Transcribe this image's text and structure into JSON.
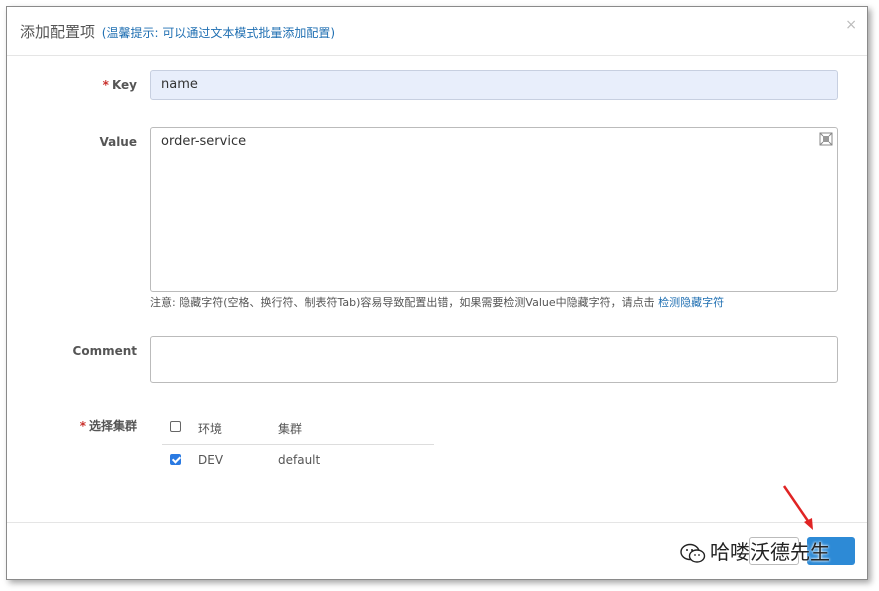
{
  "dialog": {
    "title": "添加配置项",
    "hint": "(温馨提示: 可以通过文本模式批量添加配置)",
    "close_glyph": "×"
  },
  "form": {
    "key_label": "Key",
    "key_value": "name",
    "value_label": "Value",
    "value_text": "order-service",
    "note_text": "注意: 隐藏字符(空格、换行符、制表符Tab)容易导致配置出错，如果需要检测Value中隐藏字符，请点击 ",
    "note_link": "检测隐藏字符",
    "comment_label": "Comment",
    "comment_value": "",
    "cluster_label": "选择集群",
    "required_mark": "*"
  },
  "clusters": {
    "headers": [
      "环境",
      "集群"
    ],
    "rows": [
      {
        "env": "DEV",
        "cluster": "default",
        "checked": true
      }
    ]
  },
  "watermark": {
    "text": "哈喽沃德先生"
  },
  "colors": {
    "accent": "#1f6fb2",
    "submit": "#2d8ad6",
    "required": "#c9302c",
    "arrow": "#e02424"
  },
  "icons": {
    "fullscreen": "fullscreen-icon",
    "wechat": "wechat-icon",
    "arrow": "red-arrow-annotation"
  }
}
